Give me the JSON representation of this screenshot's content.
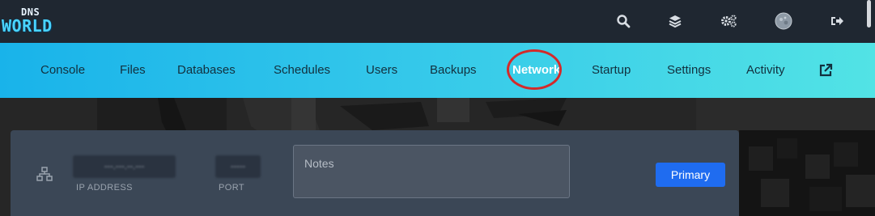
{
  "logo": {
    "top": "DNS",
    "main": "WORLD"
  },
  "topbar_icons": [
    "search-icon",
    "layers-icon",
    "cogs-icon",
    "avatar",
    "logout-icon"
  ],
  "nav": {
    "items": [
      {
        "label": "Console"
      },
      {
        "label": "Files"
      },
      {
        "label": "Databases"
      },
      {
        "label": "Schedules"
      },
      {
        "label": "Users"
      },
      {
        "label": "Backups"
      },
      {
        "label": "Network"
      },
      {
        "label": "Startup"
      },
      {
        "label": "Settings"
      },
      {
        "label": "Activity"
      }
    ],
    "active": "Network",
    "external_icon": "external-link-icon"
  },
  "allocation": {
    "ip_value": "---.---.--.---",
    "ip_label": "IP ADDRESS",
    "port_value": "-----",
    "port_label": "PORT",
    "notes_placeholder": "Notes",
    "primary_label": "Primary"
  },
  "colors": {
    "topbar": "#1f2731",
    "nav_gradient_start": "#19b3ea",
    "nav_gradient_end": "#52e3e5",
    "card": "#3b4756",
    "primary": "#1f6cf0",
    "highlight_circle": "#d42a2a"
  }
}
